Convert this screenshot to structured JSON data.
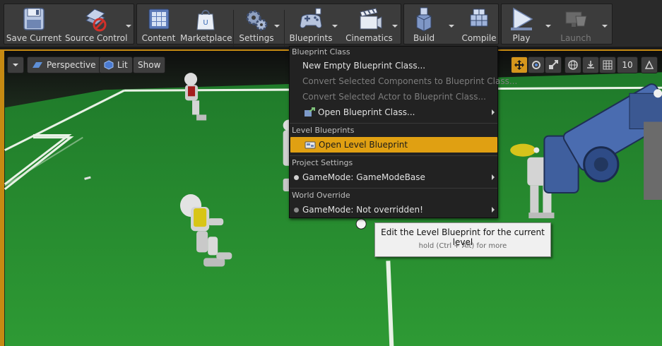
{
  "toolbar": {
    "buttons": [
      {
        "label": "Save Current",
        "icon": "floppy-disk-icon"
      },
      {
        "label": "Source Control",
        "icon": "source-control-icon"
      },
      {
        "label": "Content",
        "icon": "content-grid-icon"
      },
      {
        "label": "Marketplace",
        "icon": "marketplace-bag-icon"
      },
      {
        "label": "Settings",
        "icon": "gears-icon"
      },
      {
        "label": "Blueprints",
        "icon": "gamepad-icon"
      },
      {
        "label": "Cinematics",
        "icon": "clapperboard-icon"
      },
      {
        "label": "Build",
        "icon": "build-blocks-icon"
      },
      {
        "label": "Compile",
        "icon": "compile-cubes-icon"
      },
      {
        "label": "Play",
        "icon": "play-icon"
      },
      {
        "label": "Launch",
        "icon": "launch-icon",
        "disabled": true
      }
    ]
  },
  "viewport": {
    "view_mode": "Perspective",
    "lighting": "Lit",
    "show": "Show",
    "grid_snap_value": "10",
    "accent_color": "#d5961c"
  },
  "menu": {
    "sections": {
      "blueprint_class": "Blueprint Class",
      "level_blueprints": "Level Blueprints",
      "project_settings": "Project Settings",
      "world_override": "World Override"
    },
    "items": {
      "new_empty": "New Empty Blueprint Class...",
      "convert_components": "Convert Selected Components to Blueprint Class...",
      "convert_actor": "Convert Selected Actor to Blueprint Class...",
      "open_class": "Open Blueprint Class...",
      "open_level": "Open Level Blueprint",
      "gamemode": "GameMode: GameModeBase",
      "gamemode_override": "GameMode: Not overridden!"
    },
    "highlight_color": "#e0a012"
  },
  "tooltip": {
    "title": "Edit the Level Blueprint for the current level",
    "hint": "hold (Ctrl + Alt) for more"
  }
}
